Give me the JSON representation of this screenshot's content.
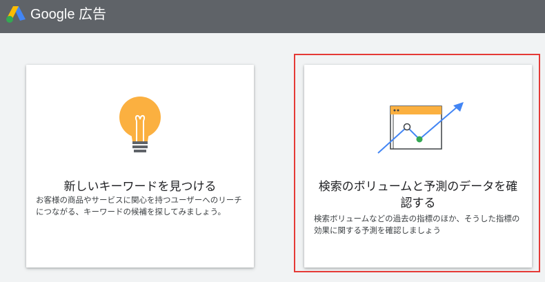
{
  "header": {
    "brand": "Google 広告",
    "logo_icon": "google-ads-logo-icon",
    "background_color": "#5f6368"
  },
  "cards": [
    {
      "title": "新しいキーワードを見つける",
      "description": "お客様の商品やサービスに関心を持つユーザーへのリーチにつながる、キーワードの候補を探してみましょう。",
      "icon": "lightbulb-icon"
    },
    {
      "title": "検索のボリュームと予測のデータを確認する",
      "description": "検索ボリュームなどの過去の指標のほか、そうした指標の効果に関する予測を確認しましょう",
      "icon": "chart-trend-icon",
      "highlighted": true
    }
  ],
  "colors": {
    "highlight_border": "#e53935",
    "bulb_yellow": "#fbb040",
    "arrow_blue": "#4285f4",
    "point_green": "#34a853"
  }
}
